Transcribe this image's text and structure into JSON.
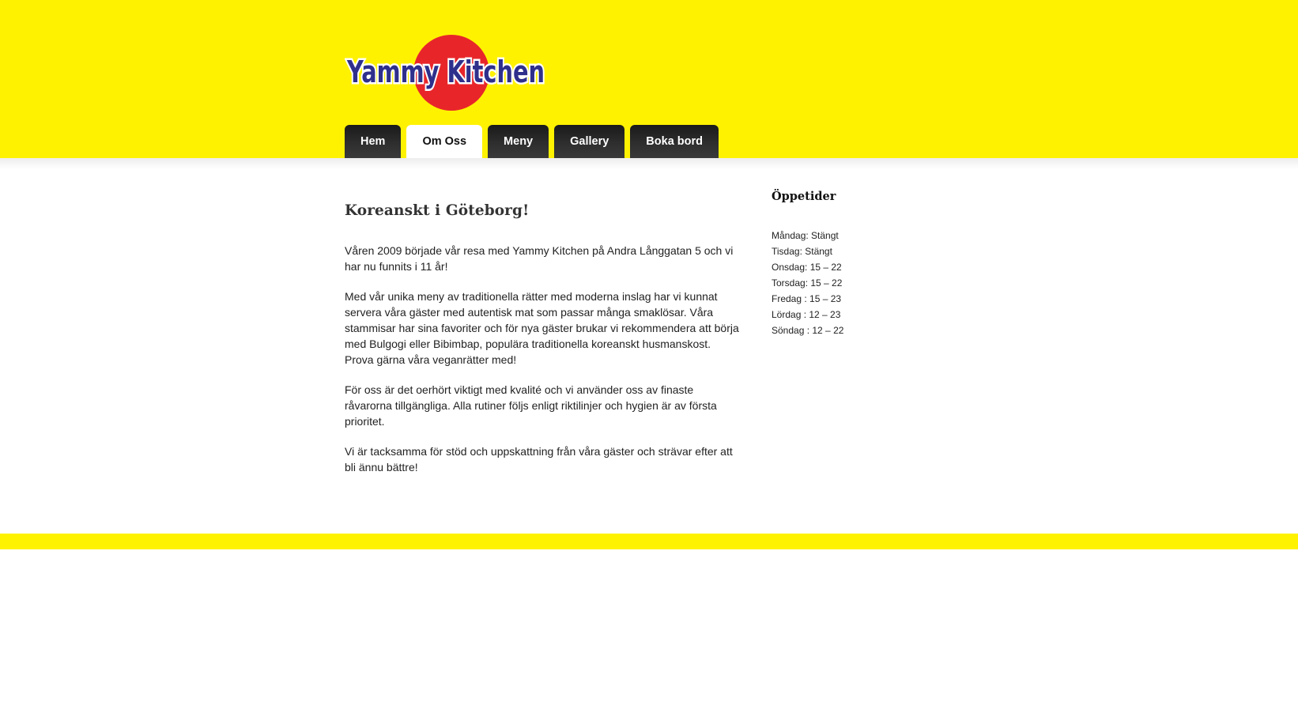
{
  "brand": {
    "name": "Yammy Kitchen",
    "colors": {
      "header_background": "#fff200",
      "logo_circle": "#e8262a",
      "logo_text": "#2f2f8c",
      "nav_tab": "#222222",
      "nav_tab_active": "#ffffff"
    }
  },
  "nav": {
    "items": [
      {
        "label": "Hem",
        "active": false
      },
      {
        "label": "Om Oss",
        "active": true
      },
      {
        "label": "Meny",
        "active": false
      },
      {
        "label": "Gallery",
        "active": false
      },
      {
        "label": "Boka bord",
        "active": false
      }
    ]
  },
  "main": {
    "title": "Koreanskt i Göteborg!",
    "paragraphs": [
      "Våren 2009 började vår resa med Yammy Kitchen på Andra Långgatan 5 och vi har nu funnits i 11 år!",
      "Med vår unika meny av traditionella rätter med moderna inslag har vi kunnat servera våra gäster med autentisk mat som passar många smaklösar. Våra stammisar har sina favoriter och för nya gäster brukar vi rekommendera att börja med Bulgogi eller Bibimbap, populära traditionella koreanskt husmanskost. Prova gärna våra veganrätter med!",
      "För oss är det oerhört viktigt med kvalité och vi använder oss av finaste råvarorna tillgängliga. Alla rutiner följs enligt riktilinjer och hygien är av första prioritet.",
      "Vi är tacksamma för stöd och uppskattning från våra gäster och strävar efter att bli ännu bättre!"
    ]
  },
  "sidebar": {
    "title": "Öppetider",
    "hours": [
      "Måndag: Stängt",
      "Tisdag: Stängt",
      "Onsdag: 15 – 22",
      "Torsdag: 15 – 22",
      "Fredag : 15 – 23",
      "Lördag : 12 – 23",
      "Söndag : 12 – 22"
    ]
  }
}
